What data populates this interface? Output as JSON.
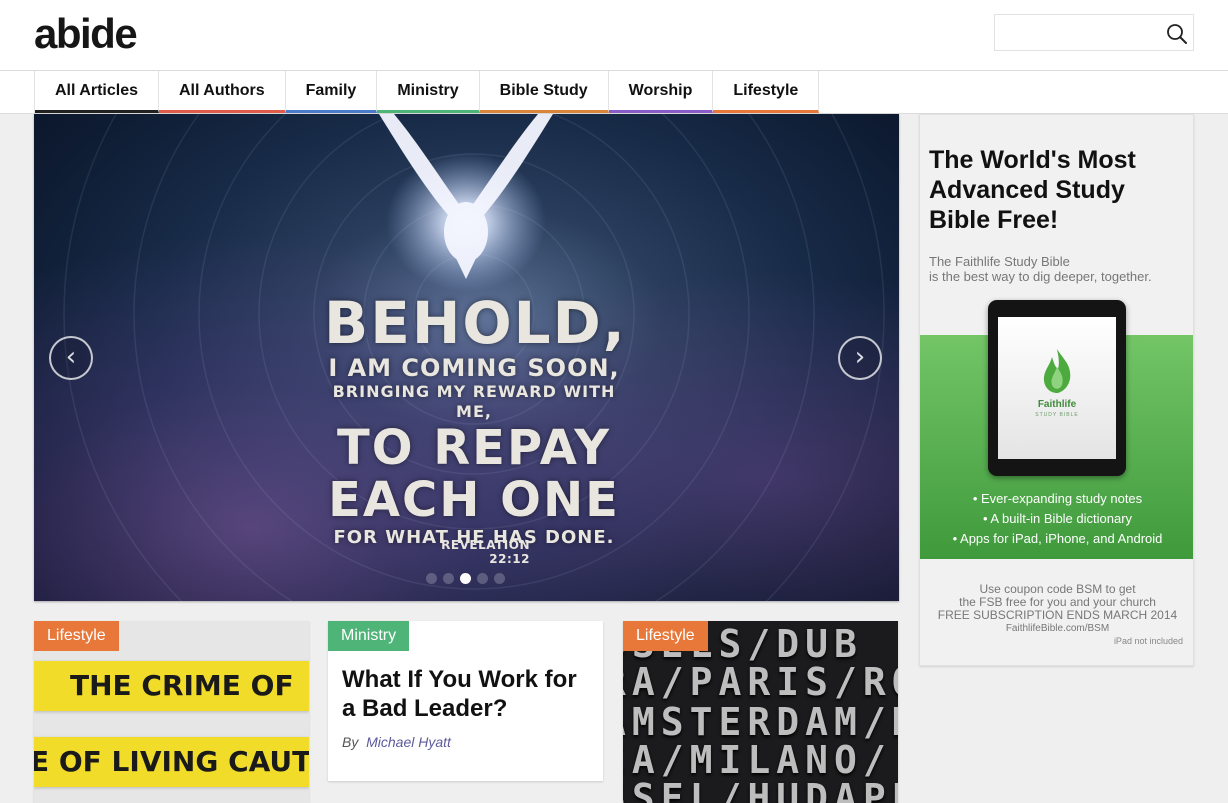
{
  "site": {
    "logo": "abide"
  },
  "search": {
    "placeholder": ""
  },
  "nav": [
    {
      "label": "All Articles",
      "color": "#222222"
    },
    {
      "label": "All Authors",
      "color": "#e05c4a"
    },
    {
      "label": "Family",
      "color": "#4a7bc8"
    },
    {
      "label": "Ministry",
      "color": "#4fb477"
    },
    {
      "label": "Bible Study",
      "color": "#d9853b"
    },
    {
      "label": "Worship",
      "color": "#8a5cc8"
    },
    {
      "label": "Lifestyle",
      "color": "#e8773a"
    }
  ],
  "hero": {
    "lines": [
      "BEHOLD,",
      "I AM COMING SOON,",
      "BRINGING MY REWARD WITH ME,",
      "TO REPAY",
      "EACH ONE",
      "FOR WHAT HE HAS DONE."
    ],
    "reference": "REVELATION 22:12",
    "prev_label": "‹",
    "next_label": "›",
    "slide_count": 5,
    "active_slide": 3
  },
  "cards": [
    {
      "category": "Lifestyle",
      "image_text_1": "THE CRIME OF",
      "image_text_2": "E OF LIVING CAUT"
    },
    {
      "category": "Ministry",
      "title": "What If You Work for a Bad Leader?",
      "by": "By",
      "author": "Michael Hyatt"
    },
    {
      "category": "Lifestyle",
      "board_rows": [
        "SSELS/DUB",
        "RA/PARIS/RO",
        "AMSTERDAM/K",
        "IA/MILANO/",
        "SSEL/HUDAPES"
      ]
    }
  ],
  "ad": {
    "headline": "The World's Most Advanced Study Bible Free!",
    "sub1": "The Faithlife Study Bible",
    "sub2": "is the best way to dig deeper, together.",
    "tablet_brand": "Faithlife",
    "tablet_brand_sub": "STUDY BIBLE",
    "features": [
      "Ever-expanding study notes",
      "A built-in Bible dictionary",
      "Apps for iPad, iPhone, and Android"
    ],
    "coupon1": "Use coupon code BSM to get",
    "coupon2": "the FSB free for you and your church",
    "coupon3": "FREE SUBSCRIPTION ENDS MARCH 2014",
    "url": "FaithlifeBible.com/BSM",
    "note": "iPad not included"
  }
}
